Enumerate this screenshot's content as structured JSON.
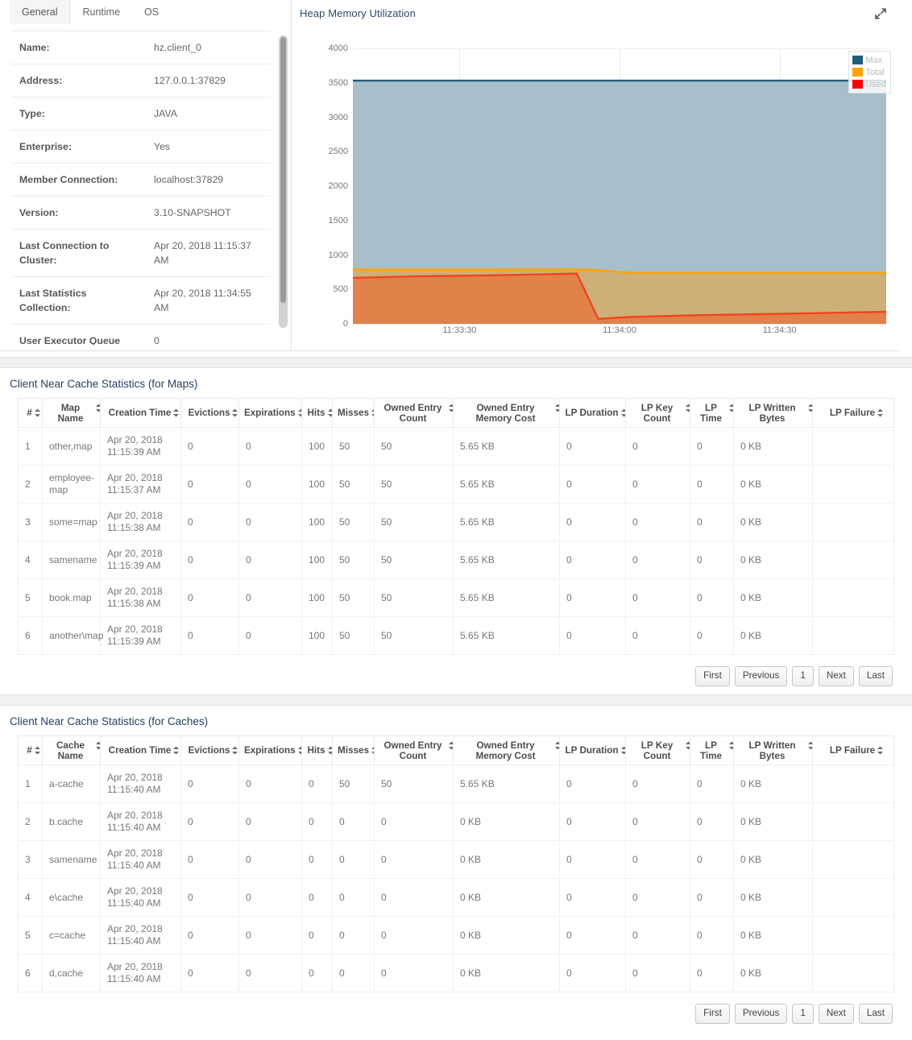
{
  "tabs": [
    {
      "label": "General",
      "active": true
    },
    {
      "label": "Runtime",
      "active": false
    },
    {
      "label": "OS",
      "active": false
    }
  ],
  "client_info": [
    {
      "key": "Name:",
      "value": "hz.client_0"
    },
    {
      "key": "Address:",
      "value": "127.0.0.1:37829"
    },
    {
      "key": "Type:",
      "value": "JAVA"
    },
    {
      "key": "Enterprise:",
      "value": "Yes"
    },
    {
      "key": "Member Connection:",
      "value": "localhost:37829"
    },
    {
      "key": "Version:",
      "value": "3.10-SNAPSHOT"
    },
    {
      "key": "Last Connection to Cluster:",
      "value": "Apr 20, 2018 11:15:37 AM"
    },
    {
      "key": "Last Statistics Collection:",
      "value": "Apr 20, 2018 11:34:55 AM"
    },
    {
      "key": "User Executor Queue",
      "value": "0"
    }
  ],
  "chart_panel": {
    "title": "Heap Memory Utilization",
    "expand_icon": "expand-icon"
  },
  "chart_data": {
    "type": "area",
    "title": "Heap Memory Utilization",
    "xlabel": "",
    "ylabel": "",
    "ylim": [
      0,
      4000
    ],
    "yticks": [
      0,
      500,
      1000,
      1500,
      2000,
      2500,
      3000,
      3500,
      4000
    ],
    "xticks": [
      "11:33:30",
      "11:34:00",
      "11:34:30"
    ],
    "xtick_positions": [
      0.2,
      0.5,
      0.8
    ],
    "grid": true,
    "legend_position": "top-right",
    "series": [
      {
        "name": "Max",
        "color": "#1f5d7a",
        "fill": "#a7bfcb",
        "x": [
          0,
          0.12,
          0.28,
          0.42,
          0.46,
          0.52,
          0.66,
          0.8,
          1.0
        ],
        "values": [
          3531,
          3531,
          3531,
          3531,
          3531,
          3531,
          3531,
          3531,
          3531
        ]
      },
      {
        "name": "Total",
        "color": "#ffa400",
        "fill": "#cdb078",
        "x": [
          0,
          0.12,
          0.28,
          0.42,
          0.46,
          0.52,
          0.66,
          0.8,
          1.0
        ],
        "values": [
          790,
          790,
          790,
          792,
          780,
          742,
          742,
          742,
          742
        ]
      },
      {
        "name": "Used",
        "color": "#f4431c",
        "fill": "#e0824a",
        "x": [
          0,
          0.12,
          0.28,
          0.42,
          0.46,
          0.52,
          0.66,
          0.8,
          1.0
        ],
        "values": [
          668,
          690,
          706,
          730,
          72,
          100,
          128,
          145,
          175
        ]
      }
    ]
  },
  "maps_section": {
    "title": "Client Near Cache Statistics (for Maps)",
    "columns": [
      "#",
      "Map Name",
      "Creation Time",
      "Evictions",
      "Expirations",
      "Hits",
      "Misses",
      "Owned Entry Count",
      "Owned Entry Memory Cost",
      "LP Duration",
      "LP Key Count",
      "LP Time",
      "LP Written Bytes",
      "LP Failure"
    ],
    "rows": [
      {
        "idx": "1",
        "name": "other,map",
        "created": "Apr 20, 2018 11:15:39 AM",
        "evictions": "0",
        "expirations": "0",
        "hits": "100",
        "misses": "50",
        "owned_count": "50",
        "owned_cost": "5.65 KB",
        "lp_duration": "0",
        "lp_key_count": "0",
        "lp_time": "0",
        "lp_written": "0 KB",
        "lp_failure": ""
      },
      {
        "idx": "2",
        "name": "employee-map",
        "created": "Apr 20, 2018 11:15:37 AM",
        "evictions": "0",
        "expirations": "0",
        "hits": "100",
        "misses": "50",
        "owned_count": "50",
        "owned_cost": "5.65 KB",
        "lp_duration": "0",
        "lp_key_count": "0",
        "lp_time": "0",
        "lp_written": "0 KB",
        "lp_failure": ""
      },
      {
        "idx": "3",
        "name": "some=map",
        "created": "Apr 20, 2018 11:15:38 AM",
        "evictions": "0",
        "expirations": "0",
        "hits": "100",
        "misses": "50",
        "owned_count": "50",
        "owned_cost": "5.65 KB",
        "lp_duration": "0",
        "lp_key_count": "0",
        "lp_time": "0",
        "lp_written": "0 KB",
        "lp_failure": ""
      },
      {
        "idx": "4",
        "name": "samename",
        "created": "Apr 20, 2018 11:15:39 AM",
        "evictions": "0",
        "expirations": "0",
        "hits": "100",
        "misses": "50",
        "owned_count": "50",
        "owned_cost": "5.65 KB",
        "lp_duration": "0",
        "lp_key_count": "0",
        "lp_time": "0",
        "lp_written": "0 KB",
        "lp_failure": ""
      },
      {
        "idx": "5",
        "name": "book.map",
        "created": "Apr 20, 2018 11:15:38 AM",
        "evictions": "0",
        "expirations": "0",
        "hits": "100",
        "misses": "50",
        "owned_count": "50",
        "owned_cost": "5.65 KB",
        "lp_duration": "0",
        "lp_key_count": "0",
        "lp_time": "0",
        "lp_written": "0 KB",
        "lp_failure": ""
      },
      {
        "idx": "6",
        "name": "another\\map",
        "created": "Apr 20, 2018 11:15:39 AM",
        "evictions": "0",
        "expirations": "0",
        "hits": "100",
        "misses": "50",
        "owned_count": "50",
        "owned_cost": "5.65 KB",
        "lp_duration": "0",
        "lp_key_count": "0",
        "lp_time": "0",
        "lp_written": "0 KB",
        "lp_failure": ""
      }
    ],
    "pager": [
      "First",
      "Previous",
      "1",
      "Next",
      "Last"
    ]
  },
  "caches_section": {
    "title": "Client Near Cache Statistics (for Caches)",
    "columns": [
      "#",
      "Cache Name",
      "Creation Time",
      "Evictions",
      "Expirations",
      "Hits",
      "Misses",
      "Owned Entry Count",
      "Owned Entry Memory Cost",
      "LP Duration",
      "LP Key Count",
      "LP Time",
      "LP Written Bytes",
      "LP Failure"
    ],
    "rows": [
      {
        "idx": "1",
        "name": "a-cache",
        "created": "Apr 20, 2018 11:15:40 AM",
        "evictions": "0",
        "expirations": "0",
        "hits": "0",
        "misses": "50",
        "owned_count": "50",
        "owned_cost": "5.65 KB",
        "lp_duration": "0",
        "lp_key_count": "0",
        "lp_time": "0",
        "lp_written": "0 KB",
        "lp_failure": ""
      },
      {
        "idx": "2",
        "name": "b.cache",
        "created": "Apr 20, 2018 11:15:40 AM",
        "evictions": "0",
        "expirations": "0",
        "hits": "0",
        "misses": "0",
        "owned_count": "0",
        "owned_cost": "0 KB",
        "lp_duration": "0",
        "lp_key_count": "0",
        "lp_time": "0",
        "lp_written": "0 KB",
        "lp_failure": ""
      },
      {
        "idx": "3",
        "name": "samename",
        "created": "Apr 20, 2018 11:15:40 AM",
        "evictions": "0",
        "expirations": "0",
        "hits": "0",
        "misses": "0",
        "owned_count": "0",
        "owned_cost": "0 KB",
        "lp_duration": "0",
        "lp_key_count": "0",
        "lp_time": "0",
        "lp_written": "0 KB",
        "lp_failure": ""
      },
      {
        "idx": "4",
        "name": "e\\cache",
        "created": "Apr 20, 2018 11:15:40 AM",
        "evictions": "0",
        "expirations": "0",
        "hits": "0",
        "misses": "0",
        "owned_count": "0",
        "owned_cost": "0 KB",
        "lp_duration": "0",
        "lp_key_count": "0",
        "lp_time": "0",
        "lp_written": "0 KB",
        "lp_failure": ""
      },
      {
        "idx": "5",
        "name": "c=cache",
        "created": "Apr 20, 2018 11:15:40 AM",
        "evictions": "0",
        "expirations": "0",
        "hits": "0",
        "misses": "0",
        "owned_count": "0",
        "owned_cost": "0 KB",
        "lp_duration": "0",
        "lp_key_count": "0",
        "lp_time": "0",
        "lp_written": "0 KB",
        "lp_failure": ""
      },
      {
        "idx": "6",
        "name": "d,cache",
        "created": "Apr 20, 2018 11:15:40 AM",
        "evictions": "0",
        "expirations": "0",
        "hits": "0",
        "misses": "0",
        "owned_count": "0",
        "owned_cost": "0 KB",
        "lp_duration": "0",
        "lp_key_count": "0",
        "lp_time": "0",
        "lp_written": "0 KB",
        "lp_failure": ""
      }
    ],
    "pager": [
      "First",
      "Previous",
      "1",
      "Next",
      "Last"
    ]
  }
}
